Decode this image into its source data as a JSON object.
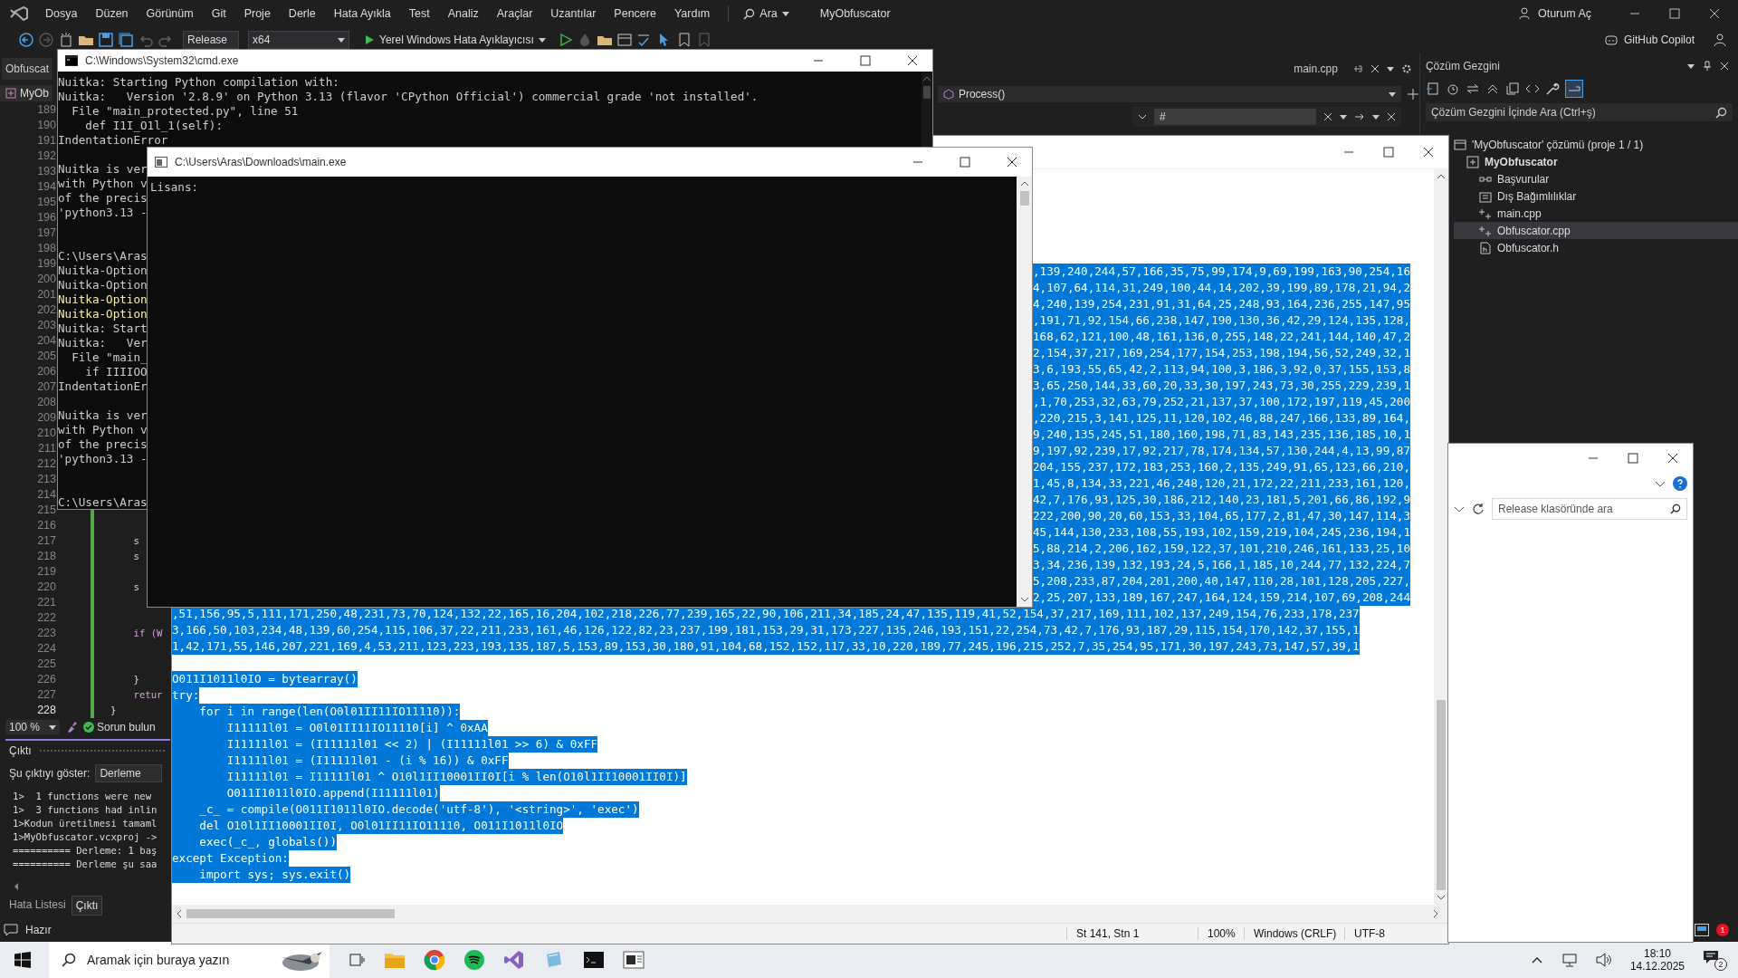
{
  "menu": {
    "items": [
      "Dosya",
      "Düzen",
      "Görünüm",
      "Git",
      "Proje",
      "Derle",
      "Hata Ayıkla",
      "Test",
      "Analiz",
      "Araçlar",
      "Uzantılar",
      "Pencere",
      "Yardım"
    ],
    "search": "Ara",
    "title": "MyObfuscator",
    "sign_in": "Oturum Aç"
  },
  "toolbar": {
    "configuration": "Release",
    "platform": "x64",
    "debugger": "Yerel Windows Hata Ayıklayıcısı",
    "copilot": "GitHub Copilot"
  },
  "editor": {
    "left_tab": "Obfuscat",
    "project": "MyOb",
    "tab": "main.cpp",
    "navigation": "Process()",
    "find": "#",
    "lines": [
      {
        "number": "189",
        "current": false
      },
      {
        "number": "190",
        "current": false
      },
      {
        "number": "191",
        "current": false
      },
      {
        "number": "192",
        "current": false
      },
      {
        "number": "193",
        "current": false
      },
      {
        "number": "194",
        "current": false
      },
      {
        "number": "195",
        "current": false
      },
      {
        "number": "196",
        "current": false
      },
      {
        "number": "197",
        "current": false
      },
      {
        "number": "198",
        "current": false
      },
      {
        "number": "199",
        "current": false
      },
      {
        "number": "200",
        "current": false
      },
      {
        "number": "201",
        "current": false
      },
      {
        "number": "202",
        "current": false
      },
      {
        "number": "203",
        "current": false
      },
      {
        "number": "204",
        "current": false
      },
      {
        "number": "205",
        "current": false
      },
      {
        "number": "206",
        "current": false
      },
      {
        "number": "207",
        "current": false
      },
      {
        "number": "208",
        "current": false
      },
      {
        "number": "209",
        "current": false
      },
      {
        "number": "210",
        "current": false
      },
      {
        "number": "211",
        "current": false
      },
      {
        "number": "212",
        "current": false
      },
      {
        "number": "213",
        "current": false
      },
      {
        "number": "214",
        "current": false
      },
      {
        "number": "215",
        "current": false
      },
      {
        "number": "216",
        "current": false
      },
      {
        "number": "217",
        "current": false,
        "code": "    s"
      },
      {
        "number": "218",
        "current": false,
        "code": "    s"
      },
      {
        "number": "219",
        "current": false
      },
      {
        "number": "220",
        "current": false,
        "code": "    s"
      },
      {
        "number": "221",
        "current": false
      },
      {
        "number": "222",
        "current": false
      },
      {
        "number": "223",
        "current": false,
        "code": "    if (W"
      },
      {
        "number": "224",
        "current": false
      },
      {
        "number": "225",
        "current": false
      },
      {
        "number": "226",
        "current": false,
        "code": "    }"
      },
      {
        "number": "227",
        "current": false,
        "code": "    retur"
      },
      {
        "number": "228",
        "current": true,
        "code": "}"
      }
    ],
    "zoom": "100 %",
    "issues": "Sorun bulun"
  },
  "output": {
    "title": "Çıktı",
    "show_label": "Şu çıktıyı göster:",
    "source": "Derleme",
    "lines": [
      "1>  1 functions were new",
      "1>  3 functions had inlin",
      "1>Kodun üretilmesi tamaml",
      "1>MyObfuscator.vcxproj ->",
      "========== Derleme: 1 baş",
      "========== Derleme şu saa"
    ],
    "tabs": [
      {
        "label": "Hata Listesi",
        "selected": false
      },
      {
        "label": "Çıktı",
        "selected": true
      }
    ]
  },
  "status_bar": {
    "text": "Hazır",
    "notifications": "1"
  },
  "solution_explorer": {
    "title": "Çözüm Gezgini",
    "search": {
      "placeholder": "Çözüm Gezgini İçinde Ara (Ctrl+ş)"
    },
    "tree": [
      {
        "label": "'MyObfuscator' çözümü (proje 1 / 1)",
        "kind": "solution",
        "selected": false,
        "children": [
          {
            "label": "MyObfuscator",
            "kind": "project",
            "selected": false,
            "children": [
              {
                "label": "Başvurular",
                "kind": "references",
                "selected": false
              },
              {
                "label": "Dış Bağımlılıklar",
                "kind": "dependencies",
                "selected": false
              },
              {
                "label": "main.cpp",
                "kind": "source",
                "selected": false
              },
              {
                "label": "Obfuscator.cpp",
                "kind": "source",
                "selected": true
              },
              {
                "label": "Obfuscator.h",
                "kind": "header",
                "selected": false
              }
            ]
          }
        ]
      }
    ]
  },
  "cmd_window": {
    "title": "C:\\Windows\\System32\\cmd.exe",
    "lines": [
      {
        "kind": "normal",
        "text": "Nuitka: Starting Python compilation with:"
      },
      {
        "kind": "normal",
        "text": "Nuitka:   Version '2.8.9' on Python 3.13 (flavor 'CPython Official') commercial grade 'not installed'."
      },
      {
        "kind": "normal",
        "text": "  File \"main_protected.py\", line 51"
      },
      {
        "kind": "normal",
        "text": "    def I1I_O1l_1(self):"
      },
      {
        "kind": "normal",
        "text": "IndentationError"
      },
      {
        "kind": "blank"
      },
      {
        "kind": "normal",
        "text": "Nuitka is ver"
      },
      {
        "kind": "normal",
        "text": "with Python v"
      },
      {
        "kind": "normal",
        "text": "of the precis"
      },
      {
        "kind": "normal",
        "text": "'python3.13 -"
      },
      {
        "kind": "blank"
      },
      {
        "kind": "blank"
      },
      {
        "kind": "normal",
        "text": "C:\\Users\\Aras"
      },
      {
        "kind": "normal",
        "text": "Nuitka-Option"
      },
      {
        "kind": "normal",
        "text": "Nuitka-Option"
      },
      {
        "kind": "warning",
        "text": "Nuitka-Option"
      },
      {
        "kind": "warning",
        "text": "Nuitka-Option"
      },
      {
        "kind": "normal",
        "text": "Nuitka: Start"
      },
      {
        "kind": "normal",
        "text": "Nuitka:   Ver"
      },
      {
        "kind": "normal",
        "text": "  File \"main_"
      },
      {
        "kind": "normal",
        "text": "    if IIIIOO"
      },
      {
        "kind": "normal",
        "text": "IndentationEr"
      },
      {
        "kind": "blank"
      },
      {
        "kind": "normal",
        "text": "Nuitka is ver"
      },
      {
        "kind": "normal",
        "text": "with Python v"
      },
      {
        "kind": "normal",
        "text": "of the precis"
      },
      {
        "kind": "normal",
        "text": "'python3.13 -"
      },
      {
        "kind": "blank"
      },
      {
        "kind": "blank"
      },
      {
        "kind": "normal",
        "text": "C:\\Users\\Aras"
      }
    ]
  },
  "app_window": {
    "title": "C:\\Users\\Aras\\Downloads\\main.exe",
    "lines": [
      "Lisans:"
    ]
  },
  "notepad": {
    "lines": [
      {
        "kind": "cut",
        "text": ",139,240,244,57,166,35,75,99,174,9,69,199,163,90,254,16"
      },
      {
        "kind": "cut",
        "text": "4,107,64,114,31,249,100,44,14,202,39,199,89,178,21,94,2"
      },
      {
        "kind": "cut",
        "text": "4,240,139,254,231,91,31,64,25,248,93,164,236,255,147,95"
      },
      {
        "kind": "cut",
        "text": ",191,71,92,154,66,238,147,190,130,36,42,29,124,135,128,"
      },
      {
        "kind": "cut",
        "text": "168,62,121,100,48,161,136,0,255,148,22,241,144,140,47,2"
      },
      {
        "kind": "cut",
        "text": "2,154,37,217,169,254,177,154,253,198,194,56,52,249,32,1"
      },
      {
        "kind": "cut",
        "text": "3,6,193,55,65,42,2,113,94,100,3,186,3,92,0,37,155,153,8"
      },
      {
        "kind": "cut",
        "text": "3,65,250,144,33,60,20,33,30,197,243,73,30,255,229,239,1"
      },
      {
        "kind": "cut",
        "text": ",1,70,253,32,63,79,252,21,137,37,100,172,197,119,45,200"
      },
      {
        "kind": "cut",
        "text": ",220,215,3,141,125,11,120,102,46,88,247,166,133,89,164,"
      },
      {
        "kind": "cut",
        "text": "9,240,135,245,51,180,160,198,71,83,143,235,136,185,10,1"
      },
      {
        "kind": "cut",
        "text": "9,197,92,239,17,92,217,78,174,134,57,130,244,4,13,99,87"
      },
      {
        "kind": "cut",
        "text": "204,155,237,172,183,253,160,2,135,249,91,65,123,66,210,"
      },
      {
        "kind": "cut",
        "text": "1,45,8,134,33,221,46,248,120,21,172,22,211,233,161,120,"
      },
      {
        "kind": "cut",
        "text": "42,7,176,93,125,30,186,212,140,23,181,5,201,66,86,192,9"
      },
      {
        "kind": "cut",
        "text": "222,200,90,20,60,153,33,104,65,177,2,81,47,30,147,114,3"
      },
      {
        "kind": "cut",
        "text": "45,144,130,233,108,55,193,102,159,219,104,245,236,194,1"
      },
      {
        "kind": "cut",
        "text": "5,88,214,2,206,162,159,122,37,101,210,246,161,133,25,10"
      },
      {
        "kind": "cut",
        "text": "3,34,236,139,132,193,24,5,166,1,185,10,244,77,132,224,7"
      },
      {
        "kind": "cut",
        "text": "5,208,233,87,204,201,200,40,147,110,28,101,128,205,227,"
      },
      {
        "kind": "cut",
        "text": "2,25,207,133,189,167,247,164,124,159,214,107,69,208,244"
      },
      {
        "kind": "text",
        "text": ",51,156,95,5,111,171,250,48,231,73,70,124,132,22,165,16,204,102,218,226,77,239,165,22,90,106,211,34,185,24,47,135,119,41,52,154,37,217,169,111,102,137,249,154,76,233,178,237"
      },
      {
        "kind": "text",
        "text": "3,166,50,103,234,48,139,60,254,115,106,37,22,211,233,161,46,126,122,82,23,237,199,181,153,29,31,173,227,135,246,193,151,22,254,73,42,7,176,93,187,29,115,154,170,142,37,155,1"
      },
      {
        "kind": "text",
        "text": "1,42,171,55,146,207,221,169,4,53,211,123,223,193,135,187,5,153,89,153,30,180,91,104,68,152,152,117,33,10,220,189,77,245,196,215,252,7,35,254,95,171,30,197,243,73,147,57,39,1"
      },
      {
        "kind": "blank"
      },
      {
        "kind": "text",
        "text": "O011I1011l0IO = bytearray()"
      },
      {
        "kind": "text",
        "text": "try:"
      },
      {
        "kind": "text",
        "text": "    for i in range(len(O0l01II11IO11110)):"
      },
      {
        "kind": "text",
        "text": "        I11111l01 = O0l01II11IO11110[i] ^ 0xAA"
      },
      {
        "kind": "text",
        "text": "        I11111l01 = (I11111l01 << 2) | (I11111l01 >> 6) & 0xFF"
      },
      {
        "kind": "text",
        "text": "        I11111l01 = (I11111l01 - (i % 16)) & 0xFF"
      },
      {
        "kind": "text",
        "text": "        I11111l01 = I11111l01 ^ O10l1II10001II0I[i % len(O10l1II10001II0I)]"
      },
      {
        "kind": "text",
        "text": "        O011I1011l0IO.append(I11111l01)"
      },
      {
        "kind": "text",
        "text": "    _c_ = compile(O011I1011l0IO.decode('utf-8'), '<string>', 'exec')"
      },
      {
        "kind": "text",
        "text": "    del O10l1II10001II0I, O0l01II11IO11110, O011I1011l0IO"
      },
      {
        "kind": "text",
        "text": "    exec(_c_, globals())"
      },
      {
        "kind": "text",
        "text": "except Exception:"
      },
      {
        "kind": "text",
        "text": "    import sys; sys.exit()"
      }
    ],
    "status": {
      "position": "St 141, Stn 1",
      "zoom": "100%",
      "line_ending": "Windows (CRLF)",
      "encoding": "UTF-8"
    }
  },
  "explorer_window": {
    "search": {
      "placeholder": "Release klasöründe ara"
    }
  },
  "taskbar": {
    "search": {
      "placeholder": "Aramak için buraya yazın"
    },
    "time": "18:10",
    "date": "14.12.2025",
    "notifications": "2"
  }
}
